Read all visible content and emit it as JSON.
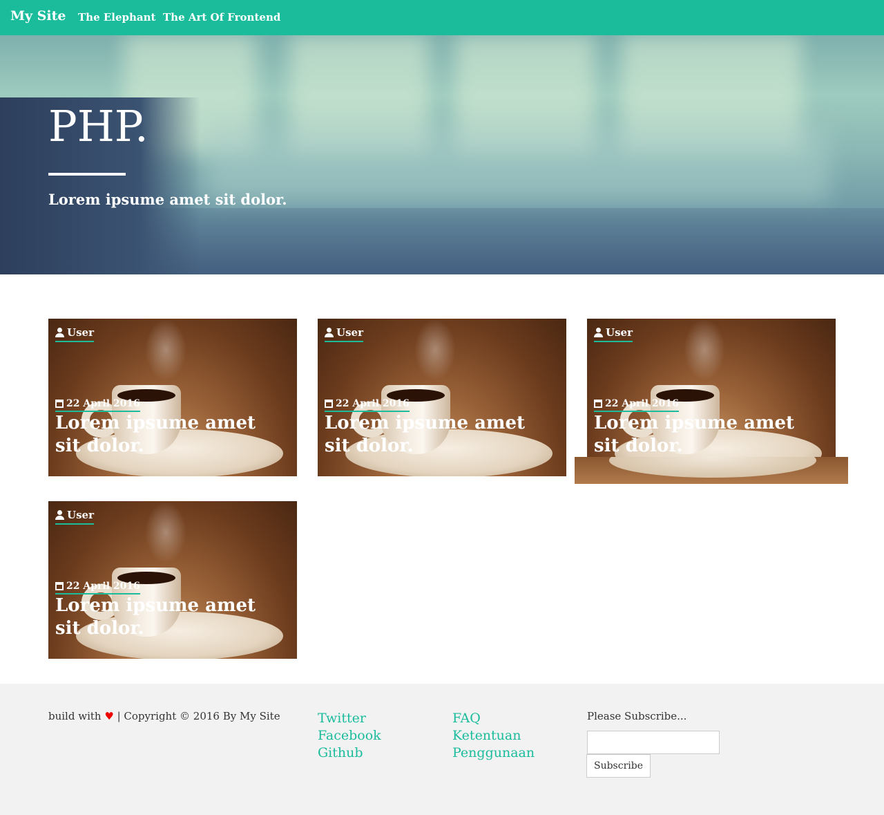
{
  "navbar": {
    "brand": "My Site",
    "links": [
      {
        "label": "The Elephant"
      },
      {
        "label": "The Art Of Frontend"
      }
    ]
  },
  "hero": {
    "title": "PHP.",
    "subtitle": "Lorem ipsume amet sit dolor."
  },
  "cards": [
    {
      "author": "User",
      "date": "22 April 2016",
      "title": "Lorem ipsume amet sit dolor."
    },
    {
      "author": "User",
      "date": "22 April 2016",
      "title": "Lorem ipsume amet sit dolor."
    },
    {
      "author": "User",
      "date": "22 April 2016",
      "title": "Lorem ipsume amet sit dolor."
    },
    {
      "author": "User",
      "date": "22 April 2016",
      "title": "Lorem ipsume amet sit dolor."
    }
  ],
  "footer": {
    "build_with": "build with",
    "copyright": "| Copyright © 2016 By My Site",
    "social_links": [
      "Twitter",
      "Facebook",
      "Github"
    ],
    "info_links": [
      "FAQ",
      "Ketentuan Penggunaan"
    ],
    "subscribe_label": "Please Subscribe...",
    "subscribe_button": "Subscribe"
  },
  "colors": {
    "accent": "#1abc9c",
    "footer_bg": "#f2f2f2",
    "heart": "#ee0000"
  },
  "icons": [
    "user-icon",
    "calendar-icon",
    "heart-icon"
  ]
}
